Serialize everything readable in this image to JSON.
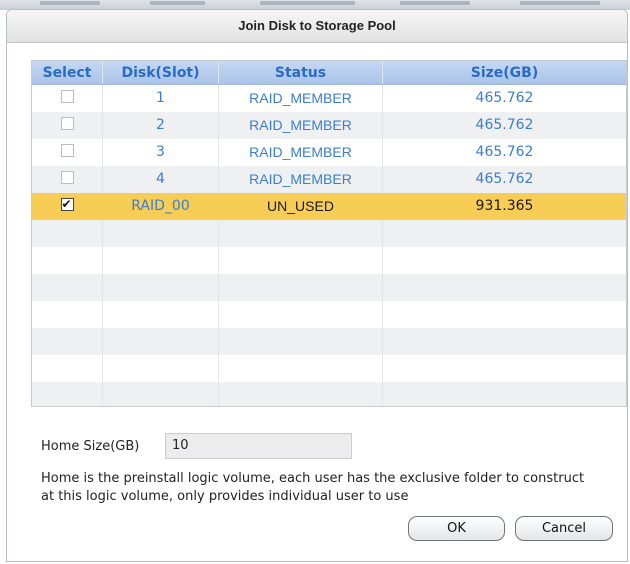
{
  "dialog": {
    "title": "Join Disk to Storage Pool"
  },
  "grid": {
    "columns": [
      "Select",
      "Disk(Slot)",
      "Status",
      "Size(GB)"
    ],
    "rows": [
      {
        "disk": "1",
        "status": "RAID_MEMBER",
        "size": "465.762",
        "checked": false,
        "enabled": false
      },
      {
        "disk": "2",
        "status": "RAID_MEMBER",
        "size": "465.762",
        "checked": false,
        "enabled": false
      },
      {
        "disk": "3",
        "status": "RAID_MEMBER",
        "size": "465.762",
        "checked": false,
        "enabled": false
      },
      {
        "disk": "4",
        "status": "RAID_MEMBER",
        "size": "465.762",
        "checked": false,
        "enabled": false
      },
      {
        "disk": "RAID_00",
        "status": "UN_USED",
        "size": "931.365",
        "checked": true,
        "enabled": true
      }
    ],
    "selected_row_color": "#f8cd56",
    "header_color": "#2a6cc4"
  },
  "home": {
    "label": "Home Size(GB)",
    "value": "10",
    "description": "Home is the preinstall logic volume, each user has the exclusive folder to construct at this logic volume, only provides individual user to use"
  },
  "buttons": {
    "ok": "OK",
    "cancel": "Cancel"
  }
}
